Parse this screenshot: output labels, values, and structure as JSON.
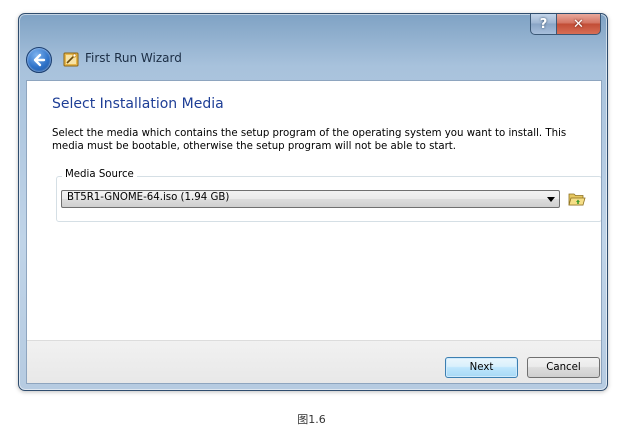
{
  "window": {
    "title": "First Run Wizard",
    "help_label": "?",
    "close_label": "✕"
  },
  "page": {
    "title": "Select Installation Media",
    "description": "Select the media which contains the setup program of the operating system you want to install. This media must be bootable, otherwise the setup program will not be able to start."
  },
  "media_source": {
    "label": "Media Source",
    "selected": "BT5R1-GNOME-64.iso (1.94 GB)"
  },
  "buttons": {
    "next": "Next",
    "cancel": "Cancel"
  },
  "figure_caption": "图1.6",
  "icons": {
    "back": "back-arrow-icon",
    "app": "wizard-icon",
    "dropdown": "chevron-down-icon",
    "browse": "folder-open-icon"
  },
  "colors": {
    "title_blue": "#1e3e96",
    "close_red": "#c24d36",
    "default_button_border": "#3c7fb1"
  }
}
